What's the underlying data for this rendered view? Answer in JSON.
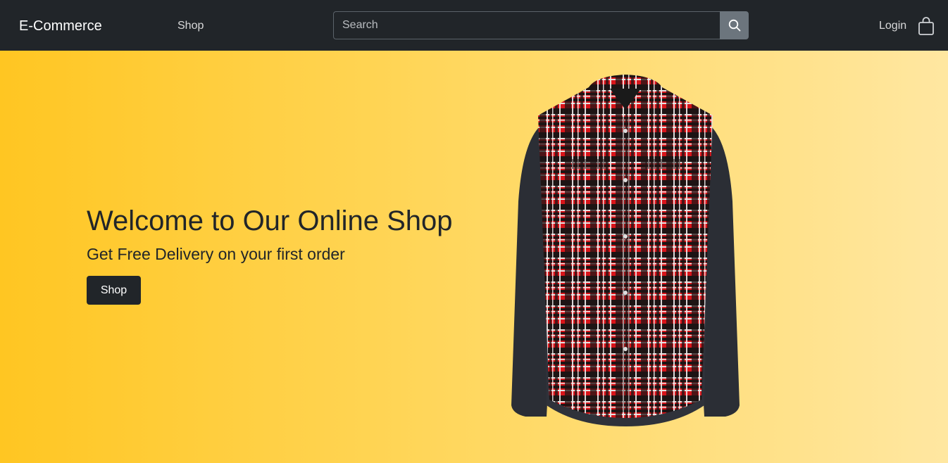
{
  "navbar": {
    "brand": "E-Commerce",
    "shop_link": "Shop",
    "search_placeholder": "Search",
    "login_link": "Login",
    "icons": {
      "search": "search-icon",
      "cart": "shopping-bag-icon"
    },
    "colors": {
      "background": "#212529",
      "search_button": "#6c757d"
    }
  },
  "hero": {
    "title": "Welcome to Our Online Shop",
    "subtitle": "Get Free Delivery on your first order",
    "cta_label": "Shop",
    "image": "plaid-shirt",
    "colors": {
      "gradient_start": "#ffc622",
      "gradient_end": "#ffe7a1",
      "text": "#212529"
    }
  }
}
